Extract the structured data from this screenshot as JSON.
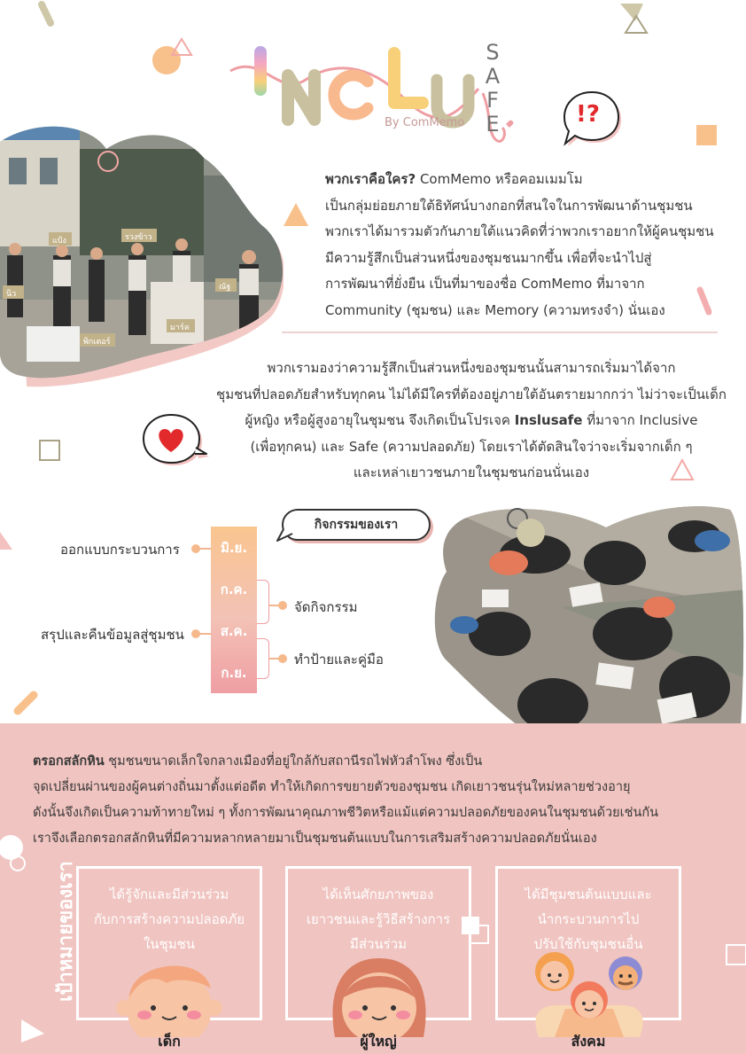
{
  "header": {
    "logo_text": "INCLU",
    "logo_safe_letters": [
      "S",
      "A",
      "F",
      "E"
    ],
    "byline": "By ComMemo"
  },
  "intro": {
    "lead": "พวกเราคือใคร?",
    "lines": [
      " ComMemo หรือคอมเมมโม",
      "เป็นกลุ่มย่อยภายใต้ธิทัศน์บางกอกที่สนใจในการพัฒนาด้านชุมชน",
      "พวกเราได้มารวมตัวกันภายใต้แนวคิดที่ว่าพวกเราอยากให้ผู้คนชุมชน",
      "มีความรู้สึกเป็นส่วนหนึ่งของชุมชนมากขึ้น เพื่อที่จะนำไปสู่",
      "การพัฒนาที่ยั่งยืน เป็นที่มาของชื่อ ComMemo ที่มาจาก",
      "Community (ชุมชน) และ Memory (ความทรงจำ) นั่นเอง"
    ]
  },
  "mission": {
    "line1": "พวกเรามองว่าความรู้สึกเป็นส่วนหนึ่งของชุมชนนั้นสามารถเริ่มมาได้จาก",
    "line2": "ชุมชนที่ปลอดภัยสำหรับทุกคน ไม่ได้มีใครที่ต้องอยู่ภายใต้อันตรายมากกว่า ไม่ว่าจะเป็นเด็ก",
    "line3_pre": "ผู้หญิง หรือผู้สูงอายุในชุมชน จึงเกิดเป็นโปรเจค ",
    "line3_bold": "Inslusafe",
    "line3_post": " ที่มาจาก Inclusive",
    "line4": "(เพื่อทุกคน) และ Safe (ความปลอดภัย) โดยเราได้ตัดสินใจว่าจะเริ่มจากเด็ก ๆ",
    "line5": "และเหล่าเยาวชนภายในชุมชนก่อนนั่นเอง"
  },
  "photo1_labels": [
    "แป้ง",
    "รวงข้าว",
    "นิว",
    "ณัฐ",
    "มาร์ค",
    "พิกเตอร์"
  ],
  "timeline": {
    "title": "กิจกรรมของเรา",
    "months": [
      "มิ.ย.",
      "ก.ค.",
      "ส.ค.",
      "ก.ย."
    ],
    "left_items": [
      "ออกแบบกระบวนการ",
      "สรุปและคืนข้อมูลสู่ชุมชน"
    ],
    "right_items": [
      "จัดกิจกรรม",
      "ทำป้ายและคู่มือ"
    ]
  },
  "context": {
    "lead": "ตรอกสลักหิน",
    "line1": " ชุมชนขนาดเล็กใจกลางเมืองที่อยู่ใกล้กับสถานีรถไฟหัวลำโพง ซึ่งเป็น",
    "line2": "จุดเปลี่ยนผ่านของผู้คนต่างถิ่นมาตั้งแต่อดีต ทำให้เกิดการขยายตัวของชุมชน เกิดเยาวชนรุ่นใหม่หลายช่วงอายุ",
    "line3": "ดังนั้นจึงเกิดเป็นความท้าทายใหม่ ๆ ทั้งการพัฒนาคุณภาพชีวิตหรือแม้แต่ความปลอดภัยของคนในชุมชนด้วยเช่นกัน",
    "line4": "เราจึงเลือกตรอกสลักหินที่มีความหลากหลายมาเป็นชุมชนต้นแบบในการเสริมสร้างความปลอดภัยนั่นเอง"
  },
  "goals": {
    "title": "เป้าหมายของเรา",
    "items": [
      {
        "lines": [
          "ได้รู้จักและมีส่วนร่วม",
          "กับการสร้างความปลอดภัย",
          "ในชุมชน"
        ],
        "label": "เด็ก"
      },
      {
        "lines": [
          "ได้เห็นศักยภาพของ",
          "เยาวชนและรู้วิธีสร้างการ",
          "มีส่วนร่วม"
        ],
        "label": "ผู้ใหญ่"
      },
      {
        "lines": [
          "ได้มีชุมชนต้นแบบและ",
          "นำกระบวนการไป",
          "ปรับใช้กับชุมชนอื่น"
        ],
        "label": "สังคม"
      }
    ]
  },
  "icons": {
    "speech_bubble_top": "exclamation-question-icon",
    "speech_bubble_mid": "heart-icon",
    "exclaim_text": "!?"
  },
  "colors": {
    "pink_bg": "#f0c4c0",
    "accent_orange": "#f8c08a",
    "accent_pink": "#ef9ea3",
    "olive": "#cfc8a8",
    "exclaim_red": "#e2292b"
  }
}
